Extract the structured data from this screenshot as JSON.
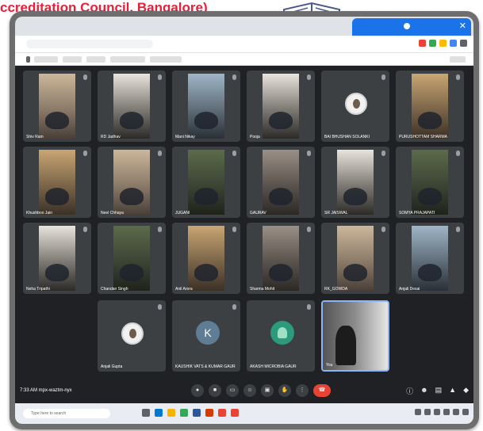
{
  "banner": {
    "text": "ccreditation Council, Bangalore)"
  },
  "colors": {
    "banner_red": "#e8203a",
    "meet_bg": "#202124",
    "tile_bg": "#3c4043",
    "end_call": "#ea4335",
    "active_tab": "#1a73e8"
  },
  "participants": [
    {
      "name": "Shiv Ram",
      "video": true
    },
    {
      "name": "RD Jadhav",
      "video": true
    },
    {
      "name": "Mani Nikay",
      "video": true
    },
    {
      "name": "Pooja",
      "video": true
    },
    {
      "name": "BAI BHUSHAN SOLANKI",
      "video": false,
      "avatar": "photo"
    },
    {
      "name": "PURUSHOTTAM SHARMA",
      "video": true
    },
    {
      "name": "Khushboo Jain",
      "video": true
    },
    {
      "name": "Neel Chhaya",
      "video": true
    },
    {
      "name": "JUGANI",
      "video": true
    },
    {
      "name": "GAURAV",
      "video": true
    },
    {
      "name": "SR JAISWAL",
      "video": true
    },
    {
      "name": "SOMYA PRAJAPATI",
      "video": true
    },
    {
      "name": "Neha Tripathi",
      "video": true
    },
    {
      "name": "Chandan Singh",
      "video": true
    },
    {
      "name": "Anil Arora",
      "video": true
    },
    {
      "name": "Sharma Mohit",
      "video": true
    },
    {
      "name": "RK_GOWDA",
      "video": true
    },
    {
      "name": "Anjali Desai",
      "video": true
    },
    {
      "name": "Anjali Gupta",
      "video": false,
      "avatar": "photo"
    },
    {
      "name": "KAUSHIK VATS & KUMAR GAUR",
      "video": false,
      "avatar": "letter",
      "initial": "K"
    },
    {
      "name": "AKASH MICROBIA GAUR",
      "video": false,
      "avatar": "tree"
    },
    {
      "name": "You",
      "video": true,
      "self": true
    }
  ],
  "controls": {
    "meeting_info": "7:33 AM   mpx-waztm-nyx",
    "icons": [
      "mic-icon",
      "camera-icon",
      "captions-icon",
      "emoji-icon",
      "present-icon",
      "raise-hand-icon",
      "more-icon",
      "end-call-icon"
    ],
    "right_icons": [
      "info-icon",
      "people-icon",
      "chat-icon",
      "activities-icon",
      "lock-icon"
    ]
  },
  "taskbar": {
    "search_placeholder": "Type here to search"
  }
}
